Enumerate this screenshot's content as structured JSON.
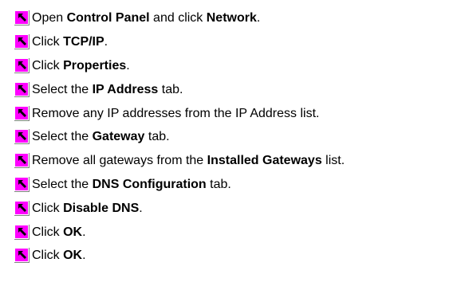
{
  "colors": {
    "icon_fill": "#ff00ff",
    "icon_shadow": "#808080",
    "icon_highlight": "#ffffff",
    "icon_arrow": "#000000",
    "text": "#000000",
    "background": "#ffffff"
  },
  "steps": [
    {
      "icon": "step-arrow-icon",
      "parts": [
        {
          "t": "Open "
        },
        {
          "t": "Control Panel",
          "b": true
        },
        {
          "t": " and click "
        },
        {
          "t": "Network",
          "b": true
        },
        {
          "t": "."
        }
      ]
    },
    {
      "icon": "step-arrow-icon",
      "parts": [
        {
          "t": "Click "
        },
        {
          "t": "TCP/IP",
          "b": true
        },
        {
          "t": "."
        }
      ]
    },
    {
      "icon": "step-arrow-icon",
      "parts": [
        {
          "t": "Click "
        },
        {
          "t": "Properties",
          "b": true
        },
        {
          "t": "."
        }
      ]
    },
    {
      "icon": "step-arrow-icon",
      "parts": [
        {
          "t": "Select the "
        },
        {
          "t": "IP Address",
          "b": true
        },
        {
          "t": " tab."
        }
      ]
    },
    {
      "icon": "step-arrow-icon",
      "parts": [
        {
          "t": "Remove any IP addresses from the IP Address list."
        }
      ]
    },
    {
      "icon": "step-arrow-icon",
      "parts": [
        {
          "t": "Select the "
        },
        {
          "t": "Gateway",
          "b": true
        },
        {
          "t": " tab."
        }
      ]
    },
    {
      "icon": "step-arrow-icon",
      "parts": [
        {
          "t": "Remove all gateways from the "
        },
        {
          "t": "Installed Gateways",
          "b": true
        },
        {
          "t": " list."
        }
      ]
    },
    {
      "icon": "step-arrow-icon",
      "parts": [
        {
          "t": "Select the "
        },
        {
          "t": "DNS Configuration",
          "b": true
        },
        {
          "t": " tab."
        }
      ]
    },
    {
      "icon": "step-arrow-icon",
      "parts": [
        {
          "t": "Click "
        },
        {
          "t": "Disable DNS",
          "b": true
        },
        {
          "t": "."
        }
      ]
    },
    {
      "icon": "step-arrow-icon",
      "parts": [
        {
          "t": "Click "
        },
        {
          "t": "OK",
          "b": true
        },
        {
          "t": "."
        }
      ]
    },
    {
      "icon": "step-arrow-icon",
      "parts": [
        {
          "t": "Click "
        },
        {
          "t": "OK",
          "b": true
        },
        {
          "t": "."
        }
      ]
    }
  ]
}
